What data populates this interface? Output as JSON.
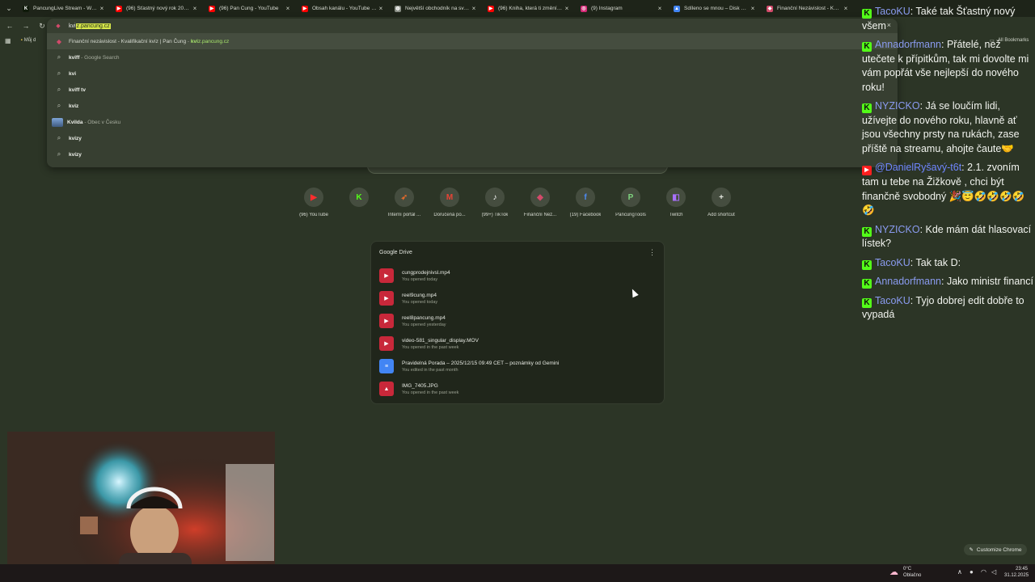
{
  "tabs": [
    {
      "title": "PancungLive Stream - Watch",
      "fav_color": "#0f1a0a",
      "fav_glyph": "K"
    },
    {
      "title": "(96) Šťastný nový rok 2026 |",
      "fav_color": "#ff0000",
      "fav_glyph": "▶"
    },
    {
      "title": "(96) Pan Čung - YouTube",
      "fav_color": "#ff0000",
      "fav_glyph": "▶"
    },
    {
      "title": "Obsah kanálu - YouTube Studi",
      "fav_color": "#ff0000",
      "fav_glyph": "▶"
    },
    {
      "title": "Největší obchodník na světě",
      "fav_color": "#8a8f86",
      "fav_glyph": "◍"
    },
    {
      "title": "(96) Kniha, která ti změní živo",
      "fav_color": "#ff0000",
      "fav_glyph": "▶"
    },
    {
      "title": "(9) Instagram",
      "fav_color": "#d62976",
      "fav_glyph": "◎"
    },
    {
      "title": "Sdíleno se mnou – Disk Goog",
      "fav_color": "#4285f4",
      "fav_glyph": "▲"
    },
    {
      "title": "Finanční Nezávislost - Kurz | C",
      "fav_color": "#d24a6a",
      "fav_glyph": "◆"
    }
  ],
  "omnibox": {
    "typed": "kvi",
    "autocomplete": "z.pancung.cz"
  },
  "suggestions": [
    {
      "icon": "pancung-icon",
      "title": "Finanční nezávislost - Kvalifikační kvíz | Pan Čung",
      "sep": " - ",
      "url_bold": "kvi",
      "url_rest": "z.pancung.cz"
    },
    {
      "icon": "search-icon",
      "bold": "kviff",
      "rest": " - Google Search"
    },
    {
      "icon": "search-icon",
      "bold": "kvi",
      "rest": ""
    },
    {
      "icon": "search-icon",
      "bold": "kviff tv",
      "rest": ""
    },
    {
      "icon": "search-icon",
      "bold": "kviz",
      "rest": ""
    },
    {
      "icon": "thumb",
      "bold": "Kvilda",
      "rest": " - Obec v Česku"
    },
    {
      "icon": "search-icon",
      "bold": "kvizy",
      "rest": ""
    },
    {
      "icon": "search-icon",
      "bold": "kvízy",
      "rest": ""
    }
  ],
  "bookmarks": {
    "first": "Můj d",
    "all_label": "All Bookmarks"
  },
  "shortcuts": [
    {
      "label": "(96) YouTube",
      "glyph": "▶",
      "color": "#ff2d2d"
    },
    {
      "label": "",
      "glyph": "K",
      "color": "#53fc18"
    },
    {
      "label": "Interní portál ...",
      "glyph": "➶",
      "color": "#e06a2c"
    },
    {
      "label": "Doručená po...",
      "glyph": "M",
      "color": "#e94335"
    },
    {
      "label": "(99+) TikTok",
      "glyph": "♪",
      "color": "#ffffff"
    },
    {
      "label": "Finanční Nez...",
      "glyph": "◆",
      "color": "#d24a6a"
    },
    {
      "label": "(19) Facebook",
      "glyph": "f",
      "color": "#4e8cf5"
    },
    {
      "label": "PancungTools",
      "glyph": "P",
      "color": "#7fd47f"
    },
    {
      "label": "Twitch",
      "glyph": "◧",
      "color": "#a970ff"
    },
    {
      "label": "Add shortcut",
      "glyph": "+",
      "color": "#e6e9e2"
    }
  ],
  "drive": {
    "title": "Google Drive",
    "files": [
      {
        "name": "cungprodejnivsl.mp4",
        "sub": "You opened today",
        "type": "video",
        "color": "#c8283a",
        "glyph": "▶"
      },
      {
        "name": "reel9cung.mp4",
        "sub": "You opened today",
        "type": "video",
        "color": "#c8283a",
        "glyph": "▶"
      },
      {
        "name": "reel8pancung.mp4",
        "sub": "You opened yesterday",
        "type": "video",
        "color": "#c8283a",
        "glyph": "▶"
      },
      {
        "name": "video-581_singular_display.MOV",
        "sub": "You opened in the past week",
        "type": "video",
        "color": "#c8283a",
        "glyph": "▶"
      },
      {
        "name": "Pravidelná Porada – 2025/12/15 09:49 CET – poznámky od Gemini",
        "sub": "You edited in the past month",
        "type": "doc",
        "color": "#4285f4",
        "glyph": "≡"
      },
      {
        "name": "IMG_7405.JPG",
        "sub": "You opened in the past week",
        "type": "image",
        "color": "#c8283a",
        "glyph": "▲"
      }
    ]
  },
  "chat": [
    {
      "platform": "kick",
      "user": "TacoKU",
      "text": "Také tak Šťastný nový všem"
    },
    {
      "platform": "kick",
      "user": "Annadorfmann",
      "text": "Přátelé, než utečete k přípitkům, tak mi dovolte mi vám popřát vše nejlepší do nového roku!"
    },
    {
      "platform": "kick",
      "user": "NYZICKO",
      "text": "Já se loučím lidi, užívejte do nového roku, hlavně ať jsou všechny prsty na rukách, zase příště na streamu, ahojte čaute🤝"
    },
    {
      "platform": "youtube",
      "user": "@DanielRyšavý-t6t",
      "text": "2.1. zvoním tam u tebe na Žižkově , chci být finančně svobodný 🎉😇🤣🤣🤣🤣🤣"
    },
    {
      "platform": "kick",
      "user": "NYZICKO",
      "text": "Kde mám dát hlasovací lístek?"
    },
    {
      "platform": "kick",
      "user": "TacoKU",
      "text": "Tak tak D:"
    },
    {
      "platform": "kick",
      "user": "Annadorfmann",
      "text": "Jako ministr financí"
    },
    {
      "platform": "kick",
      "user": "TacoKU",
      "text": "Tyjo dobrej edit dobře to vypadá"
    }
  ],
  "customize_label": "Customize Chrome",
  "taskbar": {
    "weather_temp": "0°C",
    "weather_desc": "Oblačno",
    "time": "23:45",
    "date": "31.12.2025"
  }
}
